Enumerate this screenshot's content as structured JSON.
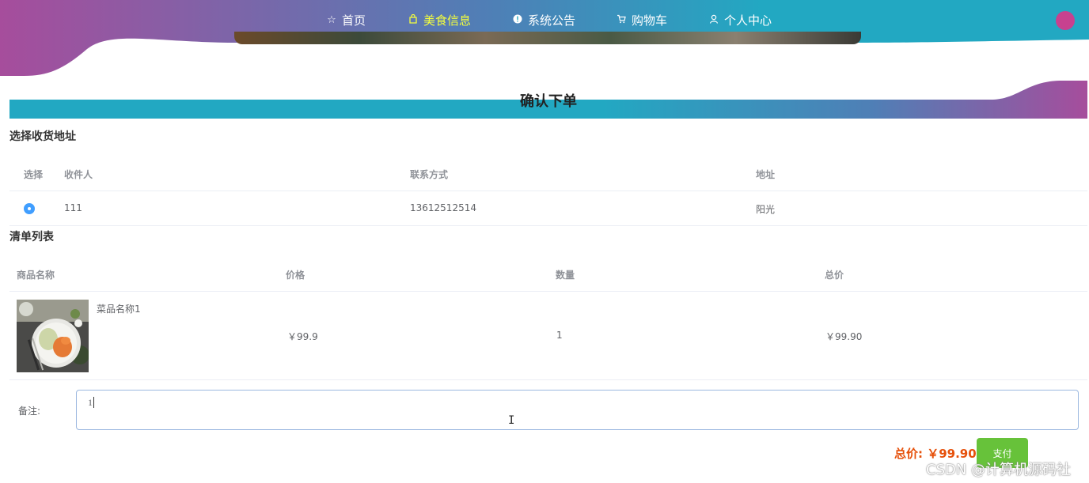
{
  "colors": {
    "nav_gradient_start": "#a64d9c",
    "nav_gradient_end": "#22a8c2",
    "active_nav": "#f5ff3c",
    "radio_selected": "#409eff",
    "total_price": "#e6500a",
    "pay_button": "#67c23a",
    "avatar": "#c7418f"
  },
  "nav": {
    "items": [
      {
        "icon": "star-icon",
        "label": "首页"
      },
      {
        "icon": "bag-icon",
        "label": "美食信息",
        "active": true
      },
      {
        "icon": "info-circle-icon",
        "label": "系统公告"
      },
      {
        "icon": "cart-icon",
        "label": "购物车"
      },
      {
        "icon": "user-icon",
        "label": "个人中心"
      }
    ]
  },
  "page_title": "确认下单",
  "address_section": {
    "title": "选择收货地址",
    "headers": [
      "选择",
      "收件人",
      "联系方式",
      "地址"
    ],
    "rows": [
      {
        "selected": true,
        "recipient": "111",
        "phone": "13612512514",
        "address": "阳光"
      }
    ]
  },
  "order_section": {
    "title": "清单列表",
    "headers": [
      "商品名称",
      "价格",
      "数量",
      "总价"
    ],
    "rows": [
      {
        "name": "菜品名称1",
        "price": "￥99.9",
        "quantity": "1",
        "total": "￥99.90"
      }
    ]
  },
  "remark": {
    "label": "备注:",
    "value": "1"
  },
  "total": {
    "text": "总价: ￥99.90"
  },
  "pay_button": "支付",
  "watermark": "CSDN @计算机源码社"
}
